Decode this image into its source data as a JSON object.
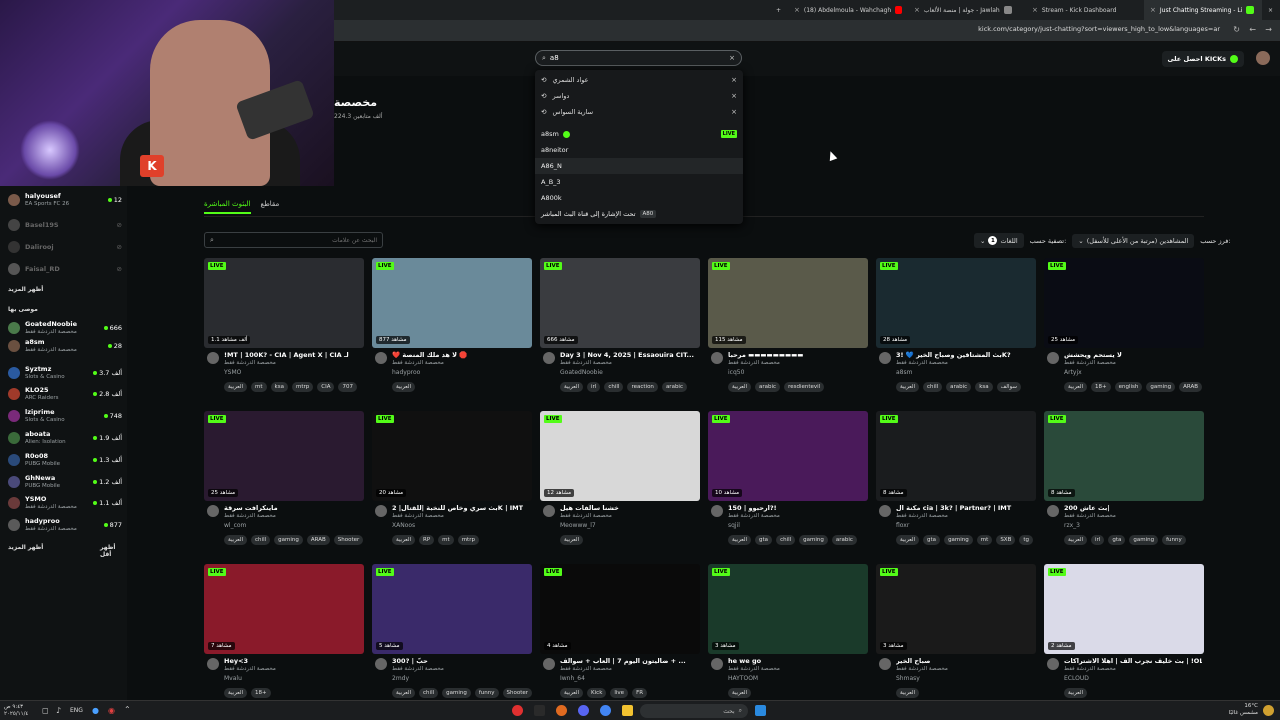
{
  "browser": {
    "tabs": [
      {
        "label": "(18) Abdelmoula - Wahchagh",
        "color": "#ff0000"
      },
      {
        "label": "جولة | منصة الألعاب - Jawlah",
        "color": "#888888"
      },
      {
        "label": "Stream - Kick Dashboard",
        "color": "#53fc18"
      },
      {
        "label": "Just Chatting Streaming - Li",
        "color": "#53fc18"
      }
    ],
    "url": "kick.com/category/just-chatting?sort=viewers_high_to_low&languages=ar"
  },
  "header": {
    "get_kicks": "احصل على KICKs"
  },
  "search": {
    "value": "a8",
    "recent": [
      "عواد الشمري",
      "دواسر",
      "سارية السواس"
    ],
    "suggestions": [
      {
        "name": "a8sm",
        "verified": true,
        "live": true
      },
      {
        "name": "a8neitor",
        "verified": false,
        "live": false
      },
      {
        "name": "A86_N",
        "verified": false,
        "live": false
      },
      {
        "name": "A_B_3",
        "verified": false,
        "live": false
      },
      {
        "name": "A800k",
        "verified": false,
        "live": false
      }
    ],
    "live_label": "LIVE",
    "tag_hint": "تحت الإشارة إلى قناة البث المباشر",
    "tag_chip": "A80"
  },
  "category": {
    "title": "مخصصة",
    "followers": "224.3 ألف متابعين"
  },
  "tabs": {
    "live": "البثوث المباشرة",
    "clips": "مقاطع"
  },
  "tag_search": {
    "placeholder": "البحث عن علامات"
  },
  "filters": {
    "sort_label": "فرز حسب:",
    "sort_value": "المشاهدين (مرتبة من الأعلى للأسفل)",
    "filter_label": "تصفية حسب:",
    "lang_label": "اللغات",
    "lang_count": "1"
  },
  "sidebar": {
    "top_items": [
      {
        "name": "halyousef",
        "cat": "EA Sports FC 26",
        "viewers": "12",
        "online": true
      },
      {
        "name": "Basel19S",
        "cat": "",
        "viewers": "",
        "online": false
      },
      {
        "name": "Dalirooj",
        "cat": "",
        "viewers": "",
        "online": false
      },
      {
        "name": "Faisal_RD",
        "cat": "",
        "viewers": "",
        "online": false
      }
    ],
    "show_more_1": "أظهر المزيد",
    "recommended_label": "موصى بها",
    "rec_items": [
      {
        "name": "GoatedNoobie",
        "cat": "مخصصة الدردشة فقط",
        "viewers": "666"
      },
      {
        "name": "a8sm",
        "cat": "مخصصة الدردشة فقط",
        "viewers": "28"
      },
      {
        "name": "Syztmz",
        "cat": "Slots & Casino",
        "viewers": "3.7 ألف"
      },
      {
        "name": "KLO25",
        "cat": "ARC Raiders",
        "viewers": "2.8 ألف"
      },
      {
        "name": "lziprime",
        "cat": "Slots & Casino",
        "viewers": "748"
      },
      {
        "name": "aboata",
        "cat": "Alien: Isolation",
        "viewers": "1.9 ألف"
      },
      {
        "name": "R0o08",
        "cat": "PUBG Mobile",
        "viewers": "1.3 ألف"
      },
      {
        "name": "GhNewa",
        "cat": "PUBG Mobile",
        "viewers": "1.2 ألف"
      },
      {
        "name": "YSMO",
        "cat": "مخصصة الدردشة فقط",
        "viewers": "1.1 ألف"
      },
      {
        "name": "hadyproo",
        "cat": "مخصصة الدردشة فقط",
        "viewers": "877"
      }
    ],
    "show_more_2": "أظهر المزيد",
    "show_less": "أظهر أقل"
  },
  "cards": [
    {
      "title": "!MT | 100K? - CIA | Agent X | CIA لـ",
      "cat": "مخصصة الدردشة فقط",
      "name": "YSMO",
      "viewers": "1.1 ألف مشاهد",
      "tags": [
        "العربية",
        "mt",
        "ksa",
        "mtrp",
        "CIA",
        "707"
      ],
      "bg": "#2a2c30"
    },
    {
      "title": "❤️ لا هد ملك المنصة 🛑",
      "cat": "مخصصة الدردشة فقط",
      "name": "hadyproo",
      "viewers": "877 مشاهد",
      "tags": [
        "العربية"
      ],
      "bg": "#6a8a9a"
    },
    {
      "title": "Day 3 | Nov 4, 2025 | Essaouira CIT...",
      "cat": "مخصصة الدردشة فقط",
      "name": "GoatedNoobie",
      "viewers": "666 مشاهد",
      "tags": [
        "العربية",
        "irl",
        "chill",
        "reaction",
        "arabic"
      ],
      "bg": "#3a3c40"
    },
    {
      "title": "مرحبا ▬▬▬▬▬▬▬▬▬",
      "cat": "مخصصة الدردشة فقط",
      "name": "icq50",
      "viewers": "115 مشاهد",
      "tags": [
        "العربية",
        "arabic",
        "resdientevil"
      ],
      "bg": "#5a5a4a"
    },
    {
      "title": "بث المشتاقين وصباح الخير 💙 !3K?",
      "cat": "مخصصة الدردشة فقط",
      "name": "a8sm",
      "viewers": "28 مشاهد",
      "tags": [
        "العربية",
        "chill",
        "arabic",
        "ksa",
        "سوالف"
      ],
      "bg": "#1a2a30"
    },
    {
      "title": "لا يستحم ويحشش",
      "cat": "مخصصة الدردشة فقط",
      "name": "Artyjx",
      "viewers": "25 مشاهد",
      "tags": [
        "العربية",
        "18+",
        "english",
        "gaming",
        "ARAB"
      ],
      "bg": "#0a0c14"
    },
    {
      "title": "ماينكرافت سرقة",
      "cat": "مخصصة الدردشة فقط",
      "name": "wl_com",
      "viewers": "25 مشاهد",
      "tags": [
        "العربية",
        "chill",
        "gaming",
        "ARAB",
        "Shooter"
      ],
      "bg": "#2a1a30"
    },
    {
      "title": "بث سري وخاص للنخبة |للقتال| 2K | IMT",
      "cat": "مخصصة الدردشة فقط",
      "name": "XANoos",
      "viewers": "20 مشاهد",
      "tags": [
        "العربية",
        "RP",
        "mt",
        "mtrp"
      ],
      "bg": "#101010"
    },
    {
      "title": "خشنا سالفات هيل",
      "cat": "مخصصة الدردشة فقط",
      "name": "Meowww_l7",
      "viewers": "12 مشاهد",
      "tags": [
        "العربية"
      ],
      "bg": "#d8d8d8"
    },
    {
      "title": "ارحبوو | 150?!",
      "cat": "مخصصة الدردشة فقط",
      "name": "sqjil",
      "viewers": "10 مشاهد",
      "tags": [
        "العربية",
        "gta",
        "chill",
        "gaming",
        "arabic"
      ],
      "bg": "#4a1a5a"
    },
    {
      "title": "مكنة ال cia | 3k? | Partner? | IMT",
      "cat": "مخصصة الدردشة فقط",
      "name": "floxr",
      "viewers": "8 مشاهد",
      "tags": [
        "العربية",
        "gta",
        "gaming",
        "mt",
        "SXB",
        "tg"
      ],
      "bg": "#1a1c1e"
    },
    {
      "title": "بث عاش 200|",
      "cat": "مخصصة الدردشة فقط",
      "name": "rzx_3",
      "viewers": "8 مشاهد",
      "tags": [
        "العربية",
        "irl",
        "gta",
        "gaming",
        "funny"
      ],
      "bg": "#2a4a3a"
    },
    {
      "title": "Hey<3",
      "cat": "مخصصة الدردشة فقط",
      "name": "Mvalu",
      "viewers": "7 مشاهد",
      "tags": [
        "العربية",
        "18+"
      ],
      "bg": "#8a1a2a"
    },
    {
      "title": "300? | حبّ",
      "cat": "مخصصة الدردشة فقط",
      "name": "2mdy",
      "viewers": "5 مشاهد",
      "tags": [
        "العربية",
        "chill",
        "gaming",
        "funny",
        "Shooter"
      ],
      "bg": "#3a2a6a"
    },
    {
      "title": "ضاليتون اليوم 7 | العاب + سوالف + ...",
      "cat": "مخصصة الدردشة فقط",
      "name": "Iwnh_64",
      "viewers": "4 مشاهد",
      "tags": [
        "العربية",
        "Kick",
        "live",
        "FR"
      ],
      "bg": "#0a0a0a"
    },
    {
      "title": "he we go",
      "cat": "مخصصة الدردشة فقط",
      "name": "HAYTOOM",
      "viewers": "3 مشاهد",
      "tags": [
        "العربية"
      ],
      "bg": "#1a3a2a"
    },
    {
      "title": "صباح الخير",
      "cat": "مخصصة الدردشة فقط",
      "name": "Shmasy",
      "viewers": "3 مشاهد",
      "tags": [
        "العربية"
      ],
      "bg": "#1a1a1a"
    },
    {
      "title": "بث خليف نجرب الف | اهلا الاشتراكات | !OL",
      "cat": "مخصصة الدردشة فقط",
      "name": "ECLOUD",
      "viewers": "2 مشاهد",
      "tags": [
        "العربية"
      ],
      "bg": "#dadae8"
    }
  ],
  "taskbar": {
    "search_placeholder": "بحث",
    "lang": "ENG",
    "time": "٩:٤٣ ص",
    "date": "٢٠٢٥/١١/٤",
    "weather": "16°C",
    "weather_desc": "مشمس غالبًا"
  }
}
